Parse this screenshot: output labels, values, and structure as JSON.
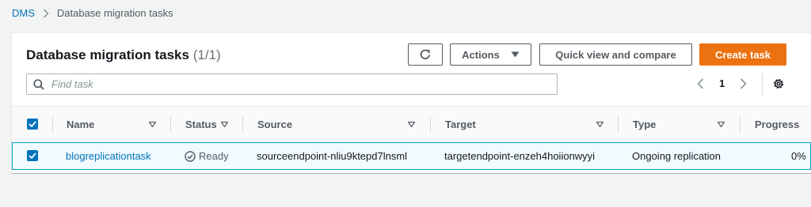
{
  "breadcrumb": {
    "root": "DMS",
    "current": "Database migration tasks"
  },
  "header": {
    "title": "Database migration tasks",
    "count": "(1/1)",
    "actions_label": "Actions",
    "quick_view_label": "Quick view and compare",
    "create_label": "Create task"
  },
  "search": {
    "placeholder": "Find task",
    "value": ""
  },
  "pagination": {
    "current_page": "1"
  },
  "table": {
    "columns": [
      "Name",
      "Status",
      "Source",
      "Target",
      "Type",
      "Progress"
    ],
    "rows": [
      {
        "selected": true,
        "name": "blogreplicationtask",
        "status": "Ready",
        "source": "sourceendpoint-nliu9ktepd7lnsml",
        "target": "targetendpoint-enzeh4hoiionwyyi",
        "type": "Ongoing replication",
        "progress": "0%"
      }
    ]
  },
  "icons": {
    "refresh": "refresh-icon",
    "actions_caret": "caret-down-icon",
    "search": "search-icon",
    "prev": "chevron-left-icon",
    "next": "chevron-right-icon",
    "settings": "gear-icon",
    "status": "check-circle-icon",
    "sort": "sort-caret-icon"
  },
  "colors": {
    "link": "#0073bb",
    "primary_button": "#ec7211",
    "selected_row_bg": "#f1faff",
    "selected_row_border": "#00a1c9"
  }
}
